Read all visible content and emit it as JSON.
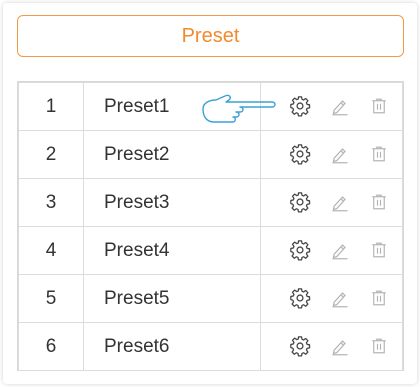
{
  "header": {
    "label": "Preset"
  },
  "presets": [
    {
      "index": "1",
      "name": "Preset1"
    },
    {
      "index": "2",
      "name": "Preset2"
    },
    {
      "index": "3",
      "name": "Preset3"
    },
    {
      "index": "4",
      "name": "Preset4"
    },
    {
      "index": "5",
      "name": "Preset5"
    },
    {
      "index": "6",
      "name": "Preset6"
    }
  ],
  "actions": [
    "gear-icon",
    "rename-pencil-icon",
    "trash-icon"
  ],
  "colors": {
    "accent": "#f28a2e",
    "gear": "#444444",
    "muted_icon": "#b5b5b5",
    "pointer": "#3aa2d6"
  }
}
